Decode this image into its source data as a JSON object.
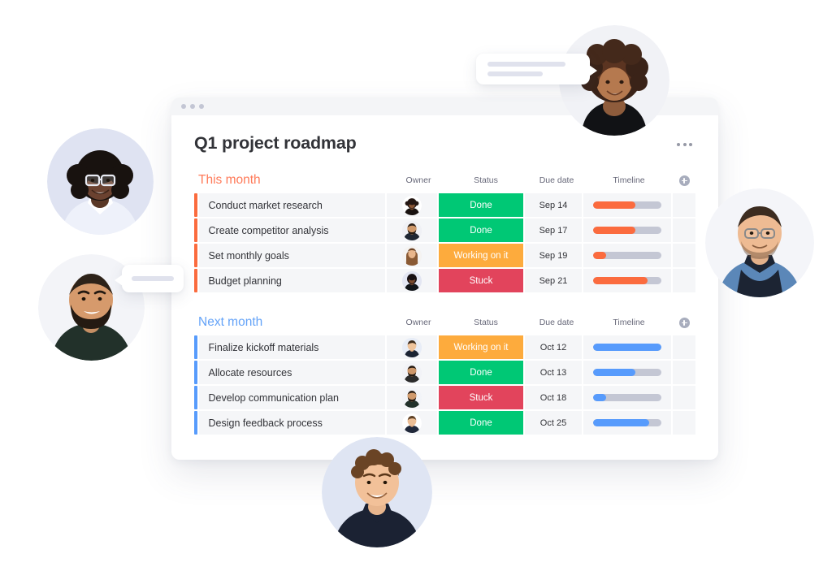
{
  "window": {
    "dots_count": 3,
    "board_title": "Q1 project roadmap",
    "menu_icon": "kebab-menu-icon"
  },
  "columns": {
    "owner": "Owner",
    "status": "Status",
    "due_date": "Due date",
    "timeline": "Timeline",
    "add_icon": "plus-circle-icon"
  },
  "colors": {
    "group_this_month": "#ff7a59",
    "group_next_month": "#64a3f8",
    "status_done": "#00c875",
    "status_working": "#fdab3d",
    "status_stuck": "#e2445c",
    "timeline_orange": "#fb6b3e",
    "timeline_blue": "#579bfc",
    "row_background": "#f5f6f8",
    "track_empty": "#c4c7d4"
  },
  "groups": [
    {
      "name": "This month",
      "accent": "#fb6b3e",
      "rows": [
        {
          "task": "Conduct market research",
          "status": "Done",
          "status_class": "st-done",
          "due": "Sep 14",
          "progress": 62
        },
        {
          "task": "Create competitor analysis",
          "status": "Done",
          "status_class": "st-done",
          "due": "Sep 17",
          "progress": 62
        },
        {
          "task": "Set monthly goals",
          "status": "Working on it",
          "status_class": "st-working",
          "due": "Sep 19",
          "progress": 19
        },
        {
          "task": "Budget planning",
          "status": "Stuck",
          "status_class": "st-stuck",
          "due": "Sep 21",
          "progress": 80
        }
      ]
    },
    {
      "name": "Next month",
      "accent": "#579bfc",
      "rows": [
        {
          "task": "Finalize kickoff materials",
          "status": "Working on it",
          "status_class": "st-working",
          "due": "Oct 12",
          "progress": 100
        },
        {
          "task": "Allocate resources",
          "status": "Done",
          "status_class": "st-done",
          "due": "Oct 13",
          "progress": 62
        },
        {
          "task": "Develop communication plan",
          "status": "Stuck",
          "status_class": "st-stuck",
          "due": "Oct 18",
          "progress": 19
        },
        {
          "task": "Design feedback process",
          "status": "Done",
          "status_class": "st-done",
          "due": "Oct 25",
          "progress": 82
        }
      ]
    }
  ],
  "floating_avatars": [
    {
      "name": "avatar-bubble-woman-glasses",
      "position": "left-upper"
    },
    {
      "name": "avatar-bubble-man-beard",
      "position": "left-lower"
    },
    {
      "name": "avatar-bubble-woman-curly-hair",
      "position": "top-right"
    },
    {
      "name": "avatar-bubble-man-denim",
      "position": "right"
    },
    {
      "name": "avatar-bubble-man-curly-hair",
      "position": "bottom-center"
    }
  ],
  "chat_bubbles": [
    {
      "name": "chat-bubble-top-right",
      "lines": 2
    },
    {
      "name": "chat-bubble-left",
      "lines": 1
    }
  ]
}
